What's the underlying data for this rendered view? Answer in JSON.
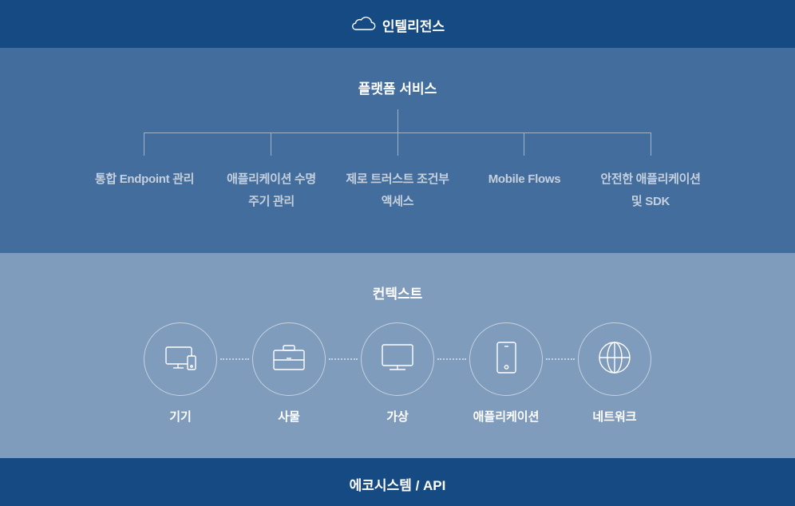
{
  "intelligence": {
    "icon": "cloud-icon",
    "title": "인텔리전스"
  },
  "platform": {
    "title": "플랫폼 서비스",
    "services": [
      {
        "line1": "통합 Endpoint 관리",
        "line2": ""
      },
      {
        "line1": "애플리케이션 수명",
        "line2": "주기 관리"
      },
      {
        "line1": "제로 트러스트 조건부",
        "line2": "액세스"
      },
      {
        "line1": "Mobile Flows",
        "line2": ""
      },
      {
        "line1": "안전한 애플리케이션",
        "line2": "및 SDK"
      }
    ]
  },
  "context": {
    "title": "컨텍스트",
    "items": [
      {
        "icon": "devices-icon",
        "label": "기기"
      },
      {
        "icon": "briefcase-icon",
        "label": "사물"
      },
      {
        "icon": "monitor-icon",
        "label": "가상"
      },
      {
        "icon": "smartphone-icon",
        "label": "애플리케이션"
      },
      {
        "icon": "globe-icon",
        "label": "네트워크"
      }
    ]
  },
  "ecosystem": {
    "title": "에코시스템 / API"
  },
  "colors": {
    "intelligence_band": "#164a83",
    "platform_band": "#436d9c",
    "context_band": "#7f9cbc",
    "ecosystem_band": "#164a83",
    "service_text": "#c5d0de",
    "title_text": "#ffffff"
  }
}
